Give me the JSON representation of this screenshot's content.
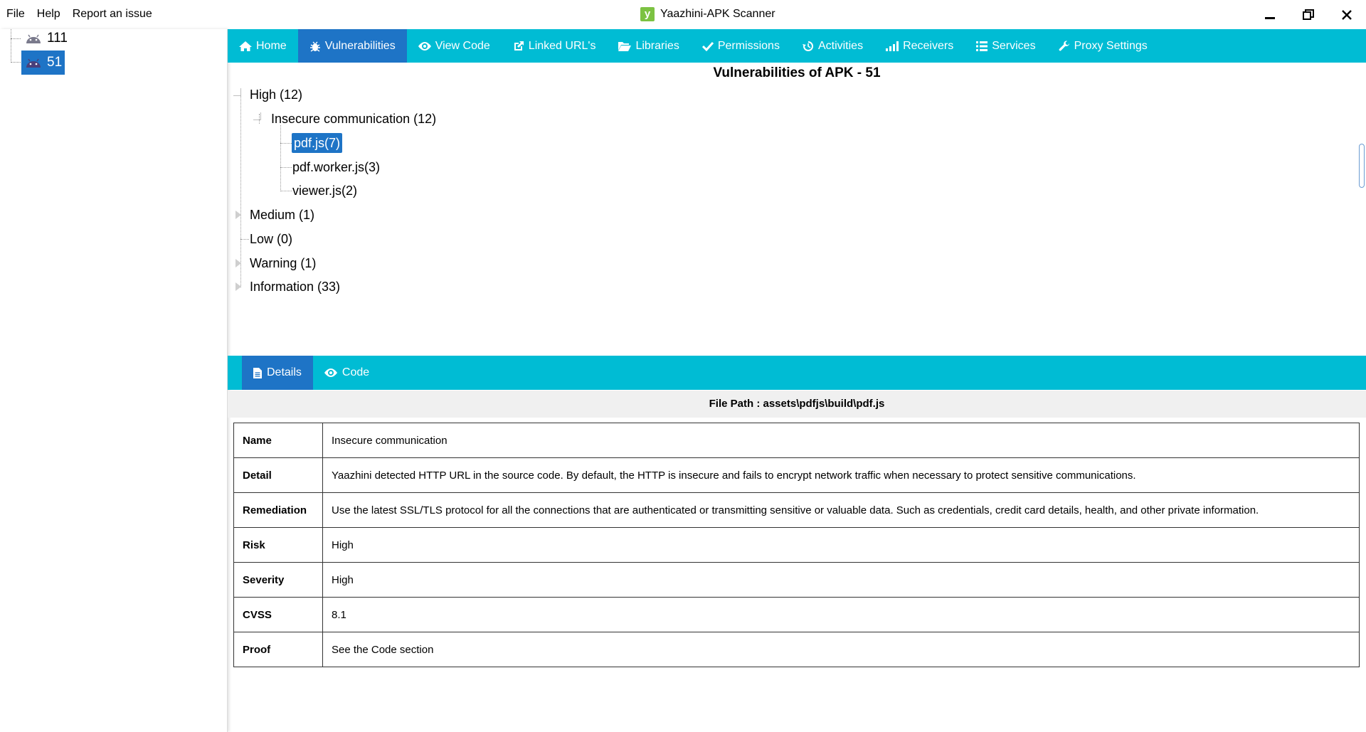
{
  "menu": {
    "file": "File",
    "help": "Help",
    "report": "Report an issue"
  },
  "app": {
    "logo": "y",
    "title": "Yaazhini-APK Scanner"
  },
  "window": {
    "minimize": "▁",
    "restore": "🗗",
    "close": "✕"
  },
  "sidebar": {
    "items": [
      {
        "label": "111"
      },
      {
        "label": "51"
      }
    ]
  },
  "nav": {
    "home": "Home",
    "vulnerabilities": "Vulnerabilities",
    "view_code": "View Code",
    "linked_urls": "Linked URL's",
    "libraries": "Libraries",
    "permissions": "Permissions",
    "activities": "Activities",
    "receivers": "Receivers",
    "services": "Services",
    "proxy_settings": "Proxy Settings"
  },
  "vulnerabilities": {
    "title": "Vulnerabilities of APK - 51",
    "high": "High (12)",
    "insecure_comm": "Insecure communication (12)",
    "files": [
      "pdf.js(7)",
      "pdf.worker.js(3)",
      "viewer.js(2)"
    ],
    "medium": "Medium (1)",
    "low": "Low (0)",
    "warning": "Warning (1)",
    "information": "Information (33)"
  },
  "detail_tabs": {
    "details": "Details",
    "code": "Code"
  },
  "file_path": "File Path : assets\\pdfjs\\build\\pdf.js",
  "details": [
    {
      "key": "Name",
      "value": "Insecure communication"
    },
    {
      "key": "Detail",
      "value": "Yaazhini detected HTTP URL in the source code. By default, the HTTP is insecure and fails to encrypt network traffic when necessary to protect sensitive communications."
    },
    {
      "key": "Remediation",
      "value": "Use the latest SSL/TLS protocol for all the connections that are authenticated or transmitting sensitive or valuable data. Such as credentials, credit card details, health, and other private information."
    },
    {
      "key": "Risk",
      "value": "High"
    },
    {
      "key": "Severity",
      "value": "High"
    },
    {
      "key": "CVSS",
      "value": "8.1"
    },
    {
      "key": "Proof",
      "value": "See the Code section"
    }
  ],
  "colors": {
    "accent": "#00bcd4",
    "selected": "#1e74c6"
  }
}
